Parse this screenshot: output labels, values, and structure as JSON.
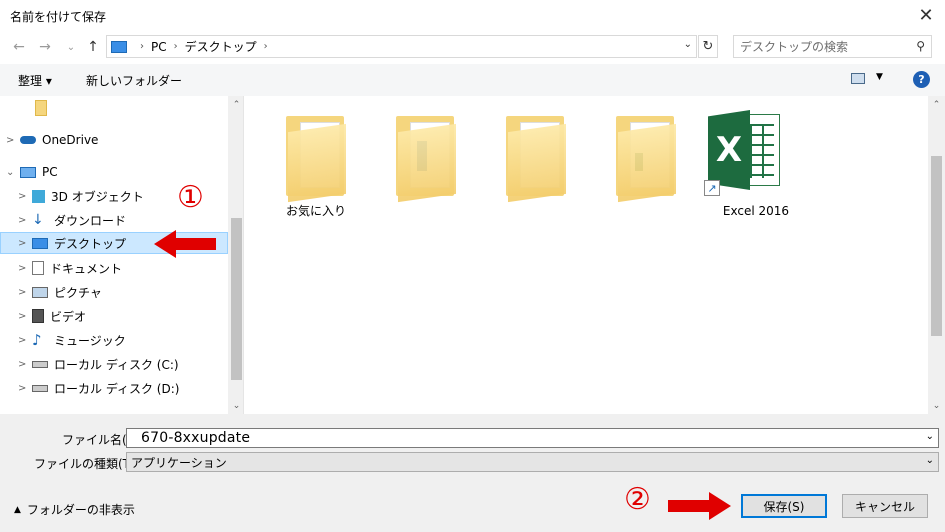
{
  "window": {
    "title": "名前を付けて保存",
    "close_glyph": "✕"
  },
  "nav": {
    "back_glyph": "←",
    "forward_glyph": "→",
    "recent_glyph": "⌄",
    "up_glyph": "↑"
  },
  "address": {
    "crumbs": [
      "PC",
      "デスクトップ"
    ],
    "sep_glyph": "›",
    "dropdown_glyph": "⌄",
    "refresh_glyph": "↻"
  },
  "search": {
    "placeholder": "デスクトップの検索",
    "icon": "search-icon",
    "icon_glyph": "⚲"
  },
  "toolbar": {
    "organize": "整理 ▾",
    "new_folder": "新しいフォルダー",
    "view_dd_glyph": "▼",
    "help": "?"
  },
  "navpane": {
    "items": [
      {
        "label": "OneDrive",
        "icon": "onedrive-icon",
        "chevron": ">"
      },
      {
        "label": "PC",
        "icon": "pc-icon",
        "chevron": "⌄"
      },
      {
        "label": "3D オブジェクト",
        "icon": "3d-objects-icon",
        "chevron": ">"
      },
      {
        "label": "ダウンロード",
        "icon": "download-icon",
        "chevron": ">"
      },
      {
        "label": "デスクトップ",
        "icon": "desktop-icon",
        "chevron": ">"
      },
      {
        "label": "ドキュメント",
        "icon": "documents-icon",
        "chevron": ">"
      },
      {
        "label": "ピクチャ",
        "icon": "pictures-icon",
        "chevron": ">"
      },
      {
        "label": "ビデオ",
        "icon": "videos-icon",
        "chevron": ">"
      },
      {
        "label": "ミュージック",
        "icon": "music-icon",
        "chevron": ">"
      },
      {
        "label": "ローカル ディスク (C:)",
        "icon": "drive-icon",
        "chevron": ">"
      },
      {
        "label": "ローカル ディスク (D:)",
        "icon": "drive-icon",
        "chevron": ">"
      }
    ],
    "selected_index": 4
  },
  "files": [
    {
      "label": "お気に入り",
      "type": "folder"
    },
    {
      "label": "",
      "type": "folder"
    },
    {
      "label": "",
      "type": "folder"
    },
    {
      "label": "",
      "type": "folder"
    },
    {
      "label": "Excel 2016",
      "type": "shortcut"
    }
  ],
  "excel_letter": "X",
  "shortcut_arrow": "↗",
  "scroll": {
    "up_glyph": "⌃",
    "down_glyph": "⌄"
  },
  "footer": {
    "filename_label": "ファイル名(N):",
    "filename_value": "670-8xxupdate",
    "filetype_label": "ファイルの種類(T):",
    "filetype_value": "アプリケーション",
    "dropdown_glyph": "⌄",
    "hide_folders": "フォルダーの非表示",
    "hide_caret": "▲",
    "save": "保存(S)",
    "cancel": "キャンセル"
  },
  "annotations": {
    "step1": "①",
    "step2": "②",
    "arrow_color": "#e00000"
  },
  "colors": {
    "selected_bg": "#cce8ff",
    "accent": "#0078d7",
    "excel_green": "#1d6b3f",
    "folder_yellow": "#f5d67e"
  }
}
